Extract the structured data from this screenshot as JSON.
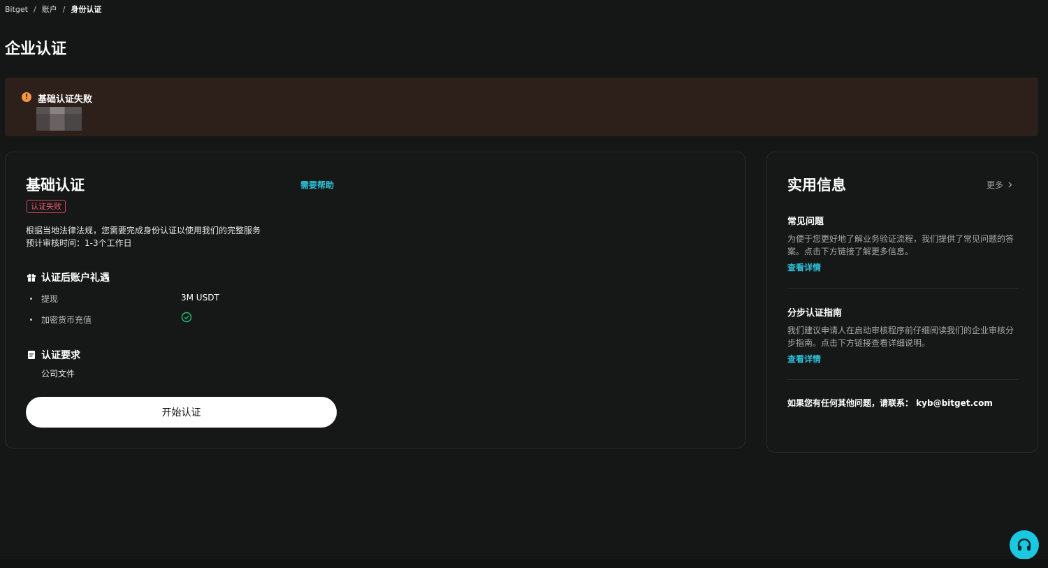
{
  "breadcrumb": {
    "items": [
      "Bitget",
      "账户"
    ],
    "current": "身份认证",
    "separator": "/"
  },
  "page_title": "企业认证",
  "alert": {
    "title": "基础认证失败",
    "icon": "warning-circle-icon",
    "color": "#f5963f"
  },
  "main_card": {
    "title": "基础认证",
    "help_label": "需要帮助",
    "status_badge": "认证失败",
    "description_line1": "根据当地法律法规，您需要完成身份认证以使用我们的完整服务",
    "description_line2": "预计审核时间：1-3个工作日",
    "benefits_title": "认证后账户礼遇",
    "benefits": [
      {
        "label": "提现",
        "value": "3M USDT"
      },
      {
        "label": "加密货币充值",
        "value_icon": "check-circle-icon"
      }
    ],
    "requirements_title": "认证要求",
    "requirement": "公司文件",
    "start_button": "开始认证"
  },
  "info_card": {
    "title": "实用信息",
    "more_label": "更多",
    "faq_title": "常见问题",
    "faq_body": "为便于您更好地了解业务验证流程，我们提供了常见问题的答案。点击下方链接了解更多信息。",
    "faq_link": "查看详情",
    "guide_title": "分步认证指南",
    "guide_body": "我们建议申请人在启动审核程序前仔细阅读我们的企业审核分步指南。点击下方链接查看详细说明。",
    "guide_link": "查看详情",
    "contact": "如果您有任何其他问题，请联系： kyb@bitget.com"
  },
  "colors": {
    "accent": "#2bc3d9",
    "danger": "#f0566e",
    "success": "#1fc27a",
    "background": "#151717"
  }
}
